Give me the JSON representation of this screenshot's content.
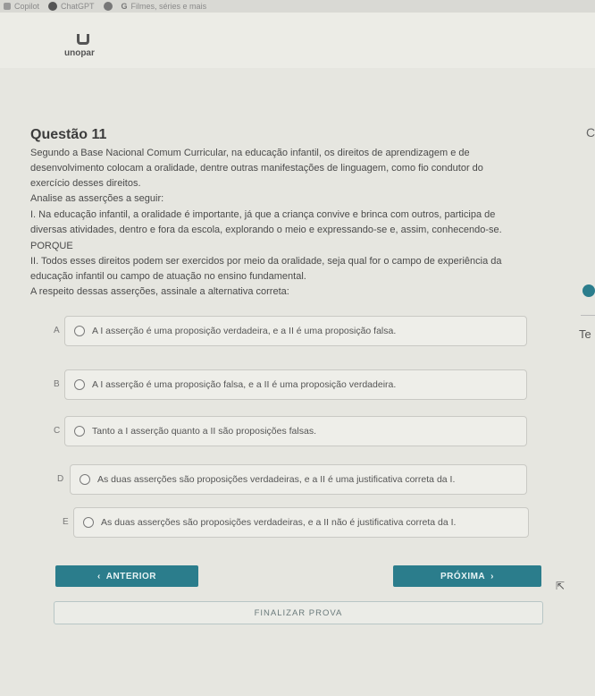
{
  "bookmarks": [
    {
      "label": "Copilot",
      "icon": "copilot-icon"
    },
    {
      "label": "ChatGPT",
      "icon": "chatgpt-icon"
    },
    {
      "label": "",
      "icon": "round-icon"
    },
    {
      "label": "Filmes, séries e mais",
      "icon": "g-icon"
    }
  ],
  "brand": {
    "name": "unopar"
  },
  "question": {
    "title": "Questão 11",
    "paragraphs": [
      "Segundo a Base Nacional Comum Curricular, na educação infantil, os direitos de aprendizagem e de",
      "desenvolvimento colocam a oralidade, dentre outras manifestações de linguagem, como fio condutor do",
      "exercício desses direitos.",
      "Analise as asserções a seguir:",
      "I. Na educação infantil, a oralidade é importante, já que a criança convive e brinca com outros, participa de",
      "diversas atividades, dentro e fora da escola, explorando o meio e expressando-se e, assim, conhecendo-se.",
      "PORQUE",
      "II. Todos esses direitos podem ser exercidos por meio da oralidade, seja qual for o campo de experiência da",
      "educação infantil ou campo de atuação no ensino fundamental.",
      "A respeito dessas asserções, assinale a alternativa correta:"
    ]
  },
  "options": [
    {
      "letter": "A",
      "text": "A I asserção é uma proposição verdadeira, e a II é uma proposição falsa."
    },
    {
      "letter": "B",
      "text": "A I asserção é uma proposição falsa, e a II é uma proposição verdadeira."
    },
    {
      "letter": "C",
      "text": "Tanto a I asserção quanto a II são proposições falsas."
    },
    {
      "letter": "D",
      "text": "As duas asserções são proposições verdadeiras, e a II é uma justificativa correta da I."
    },
    {
      "letter": "E",
      "text": "As duas asserções são proposições verdadeiras, e a II não é justificativa correta da I."
    }
  ],
  "nav": {
    "prev_label": "ANTERIOR",
    "next_label": "PRÓXIMA",
    "finish_label": "FINALIZAR PROVA"
  },
  "side": {
    "text_fragment": "Te",
    "scroll_glyph": "C"
  },
  "colors": {
    "accent": "#2b7d8c",
    "background": "#e6e6e0"
  }
}
